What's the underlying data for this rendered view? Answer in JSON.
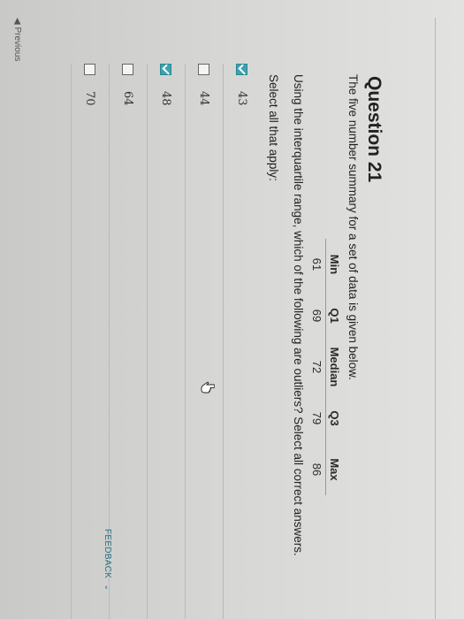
{
  "question": {
    "title": "Question 21",
    "text": "The five number summary for a set of data is given below.",
    "instruction": "Using the interquartile range, which of the following are outliers? Select all correct answers.",
    "select_all": "Select all that apply:"
  },
  "summary_table": {
    "headers": [
      "Min",
      "Q1",
      "Median",
      "Q3",
      "Max"
    ],
    "values": [
      "61",
      "69",
      "72",
      "79",
      "86"
    ]
  },
  "options": [
    {
      "label": "43",
      "checked": true
    },
    {
      "label": "44",
      "checked": false
    },
    {
      "label": "48",
      "checked": true
    },
    {
      "label": "64",
      "checked": false
    },
    {
      "label": "70",
      "checked": false
    }
  ],
  "nav": {
    "previous": "Previous",
    "feedback": "FEEDBACK"
  },
  "colors": {
    "checked": "#3aa3b0",
    "link": "#2b6c85"
  }
}
